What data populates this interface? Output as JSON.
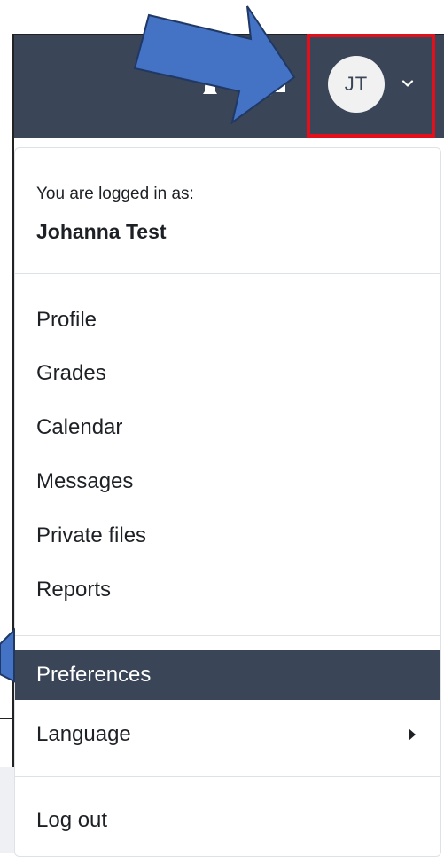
{
  "user_menu": {
    "avatar_initials": "JT",
    "highlight_color": "#e3101c",
    "navbar_color": "#3a4557"
  },
  "dropdown": {
    "logged_in_label": "You are logged in as:",
    "user_name": "Johanna Test",
    "items_group1": [
      {
        "label": "Profile"
      },
      {
        "label": "Grades"
      },
      {
        "label": "Calendar"
      },
      {
        "label": "Messages"
      },
      {
        "label": "Private files"
      },
      {
        "label": "Reports"
      }
    ],
    "items_group2": [
      {
        "label": "Preferences",
        "active": true
      },
      {
        "label": "Language",
        "has_submenu": true
      }
    ],
    "items_group3": [
      {
        "label": "Log out"
      }
    ]
  },
  "icons": {
    "bell": "notification-bell-icon",
    "chat": "messages-chat-icon",
    "caret": "chevron-down-icon",
    "submenu": "caret-right-icon",
    "annotation_arrow": "annotation-arrow"
  }
}
